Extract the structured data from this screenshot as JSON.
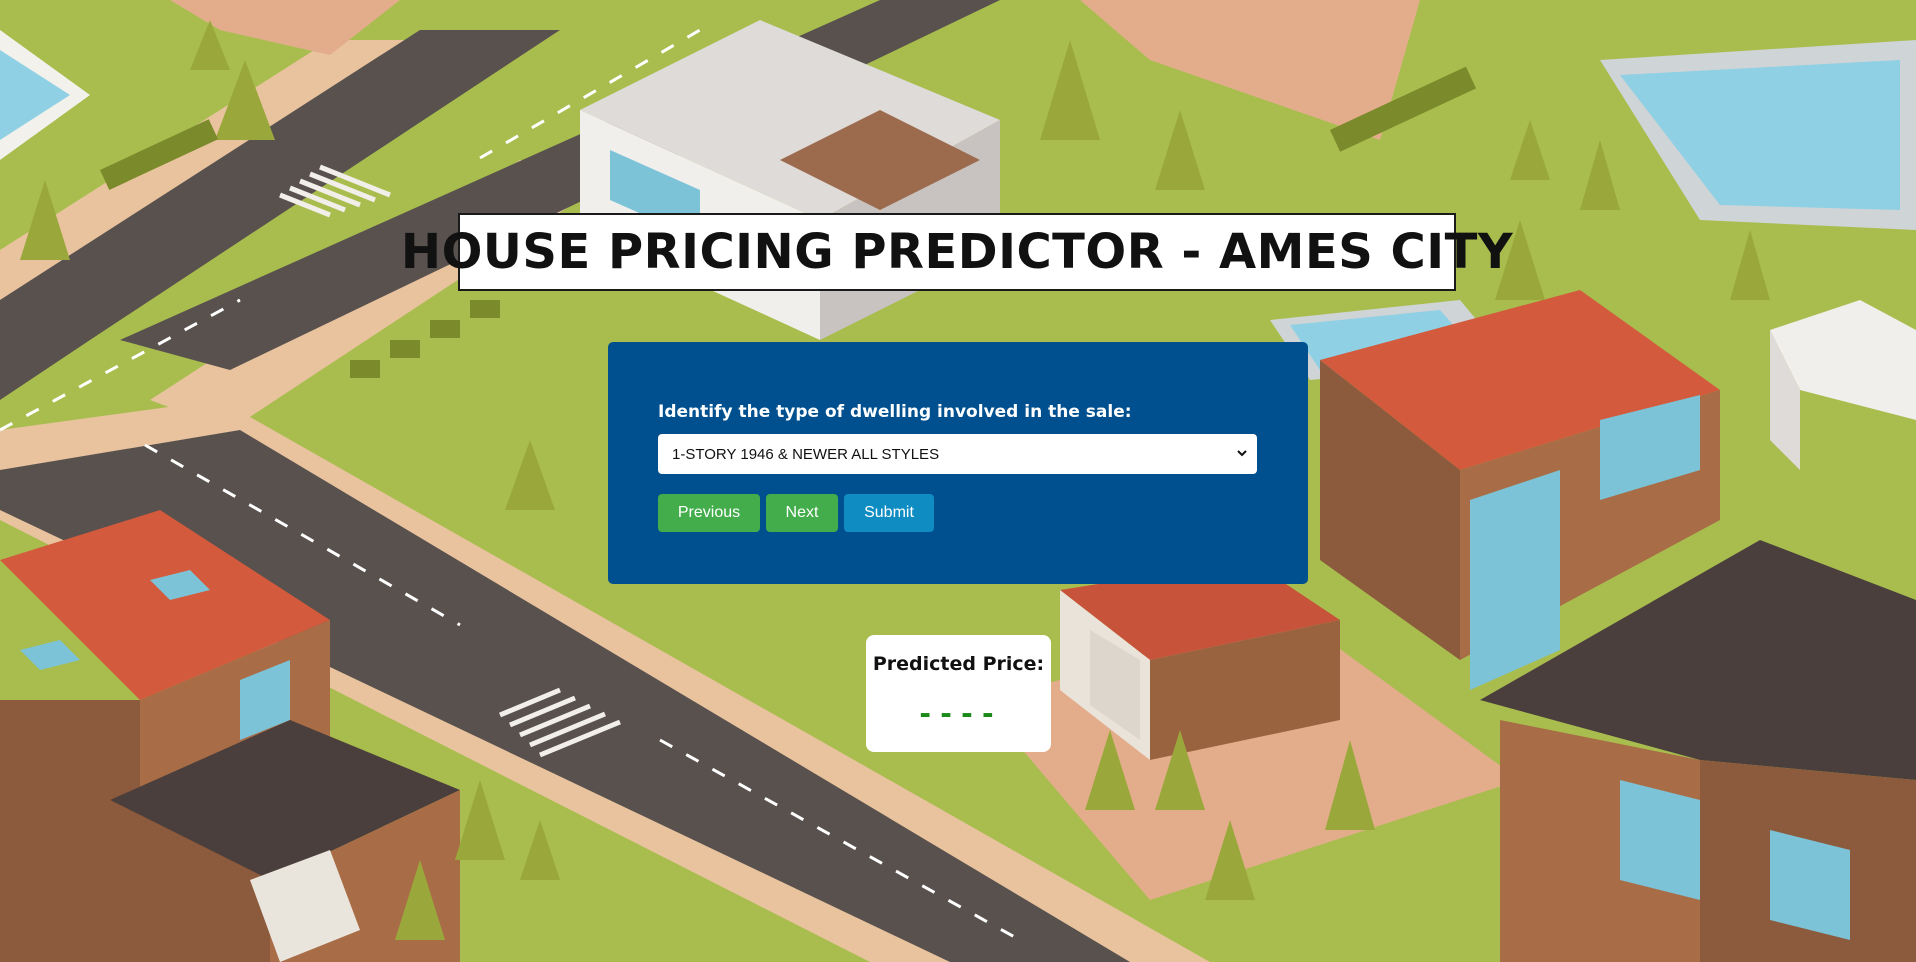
{
  "header": {
    "title": "HOUSE PRICING PREDICTOR - AMES CITY"
  },
  "form": {
    "question_label": "Identify the type of dwelling involved in the sale:",
    "dwelling_select": {
      "selected_value": "1-STORY 1946 & NEWER ALL STYLES"
    },
    "buttons": {
      "previous_label": "Previous",
      "next_label": "Next",
      "submit_label": "Submit"
    }
  },
  "result": {
    "label": "Predicted Price:",
    "value": "----"
  },
  "colors": {
    "form_background": "#00508f",
    "previous_next_button": "#43ad4c",
    "submit_button": "#0f8cc2",
    "price_text": "#1a8a1a"
  },
  "background": {
    "description_icon": "isometric-city-illustration"
  }
}
